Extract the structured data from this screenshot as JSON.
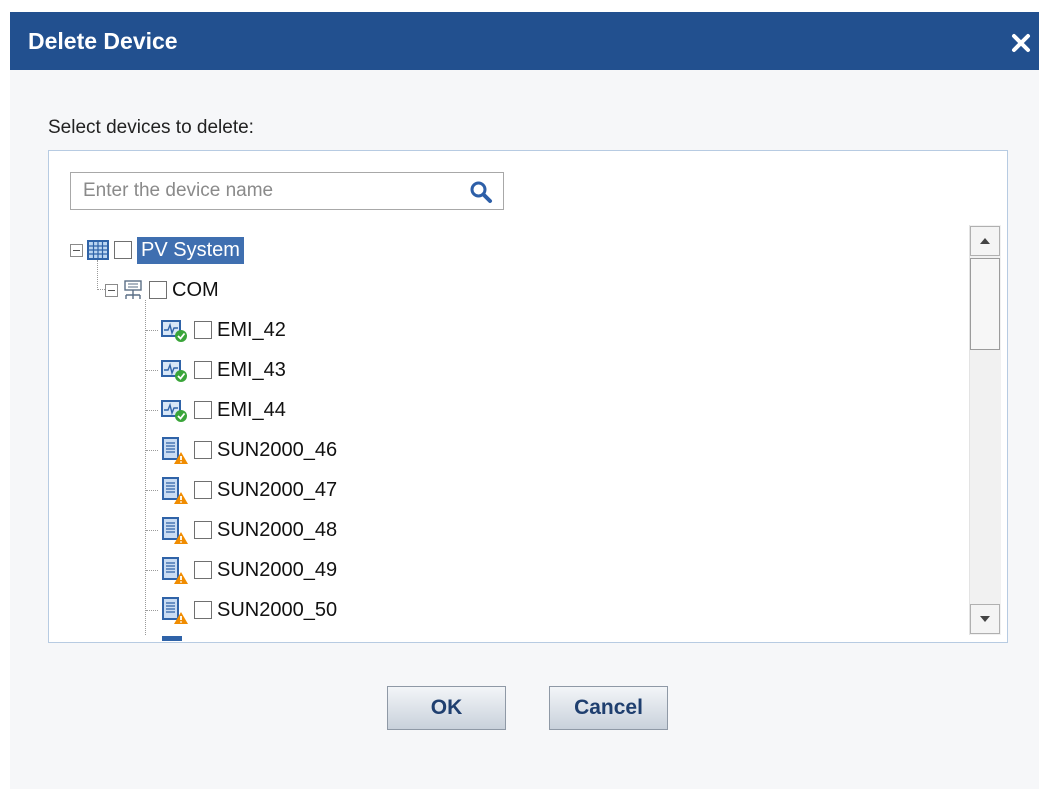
{
  "dialog": {
    "title": "Delete Device",
    "prompt": "Select devices to delete:"
  },
  "search": {
    "placeholder": "Enter the device name",
    "value": ""
  },
  "tree": {
    "root": {
      "label": "PV System",
      "icon": "building-icon",
      "expanded": true,
      "checked": false,
      "selected": true
    },
    "group": {
      "label": "COM",
      "icon": "logger-icon",
      "expanded": true,
      "checked": false
    },
    "items": [
      {
        "label": "EMI_42",
        "icon": "emi-ok-icon",
        "status": "ok",
        "checked": false
      },
      {
        "label": "EMI_43",
        "icon": "emi-ok-icon",
        "status": "ok",
        "checked": false
      },
      {
        "label": "EMI_44",
        "icon": "emi-ok-icon",
        "status": "ok",
        "checked": false
      },
      {
        "label": "SUN2000_46",
        "icon": "inverter-warning-icon",
        "status": "warning",
        "checked": false
      },
      {
        "label": "SUN2000_47",
        "icon": "inverter-warning-icon",
        "status": "warning",
        "checked": false
      },
      {
        "label": "SUN2000_48",
        "icon": "inverter-warning-icon",
        "status": "warning",
        "checked": false
      },
      {
        "label": "SUN2000_49",
        "icon": "inverter-warning-icon",
        "status": "warning",
        "checked": false
      },
      {
        "label": "SUN2000_50",
        "icon": "inverter-warning-icon",
        "status": "warning",
        "checked": false
      }
    ]
  },
  "buttons": {
    "ok": "OK",
    "cancel": "Cancel"
  },
  "colors": {
    "title_bar": "#22508f",
    "selection": "#3f6fb0",
    "ok_status": "#3aa53a",
    "warning_status": "#f08c00"
  }
}
